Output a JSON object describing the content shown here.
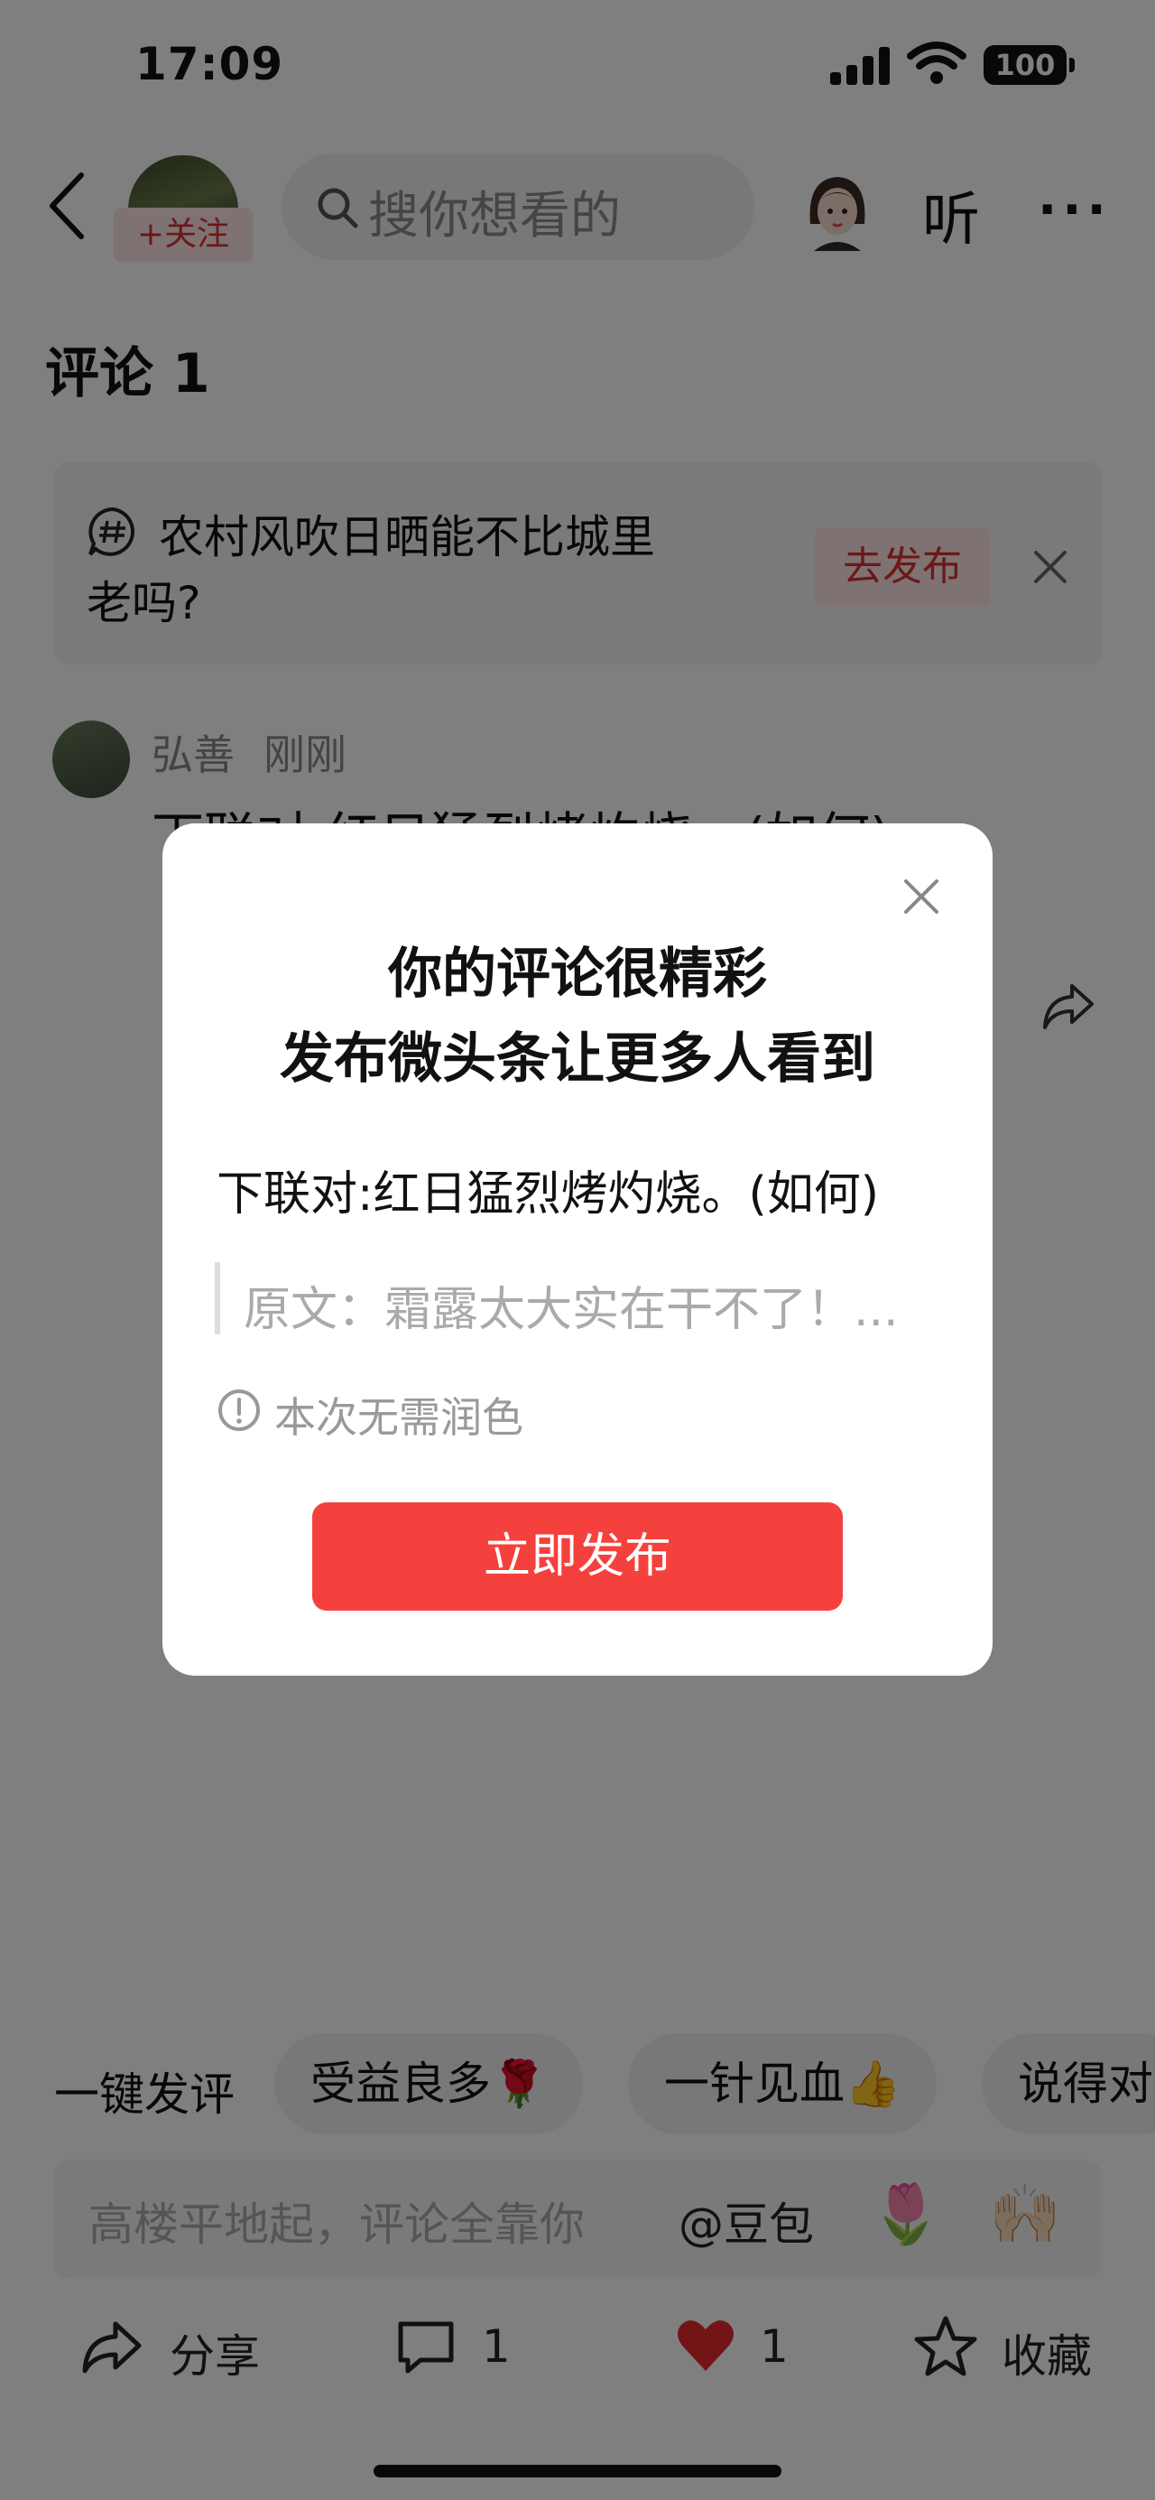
{
  "status_bar": {
    "time": "17:09",
    "battery": "100"
  },
  "header": {
    "follow_label": "+关注",
    "search_placeholder": "搜你想看的",
    "listen_label": "听",
    "more_label": "···"
  },
  "page_title": "评论 1",
  "topic": {
    "line1": "农村风吹日晒能不比城里",
    "line2": "老吗?",
    "button": "去发布"
  },
  "comment": {
    "user": "弘善",
    "time": "刚刚",
    "text": "下联对:红日猛烈烤灼烧。(如何)"
  },
  "quick_replies": {
    "label": "一键发评",
    "chips": [
      "受益良多🌹",
      "一针见血👍",
      "说得对"
    ]
  },
  "input": {
    "placeholder": "高楼平地起，评论全靠你",
    "at_label": "@豆包",
    "emoji1": "🌷",
    "emoji2": "🙌🏻"
  },
  "bottom_bar": {
    "share": "分享",
    "comments": "1",
    "likes": "1",
    "favorite": "收藏"
  },
  "modal": {
    "title_line1": "你的评论很精彩",
    "title_line2": "发布微头条让更多人看到",
    "text": "下联对:红日猛烈烤灼烧。(如何)",
    "quote": "原文：霜露太大实在干不了！...",
    "note": "本次无需润色",
    "button": "立即发布"
  },
  "colors": {
    "accent_red": "#f5413e",
    "follow_pink": "#fde4e4",
    "heart_red": "#e62a2f"
  }
}
